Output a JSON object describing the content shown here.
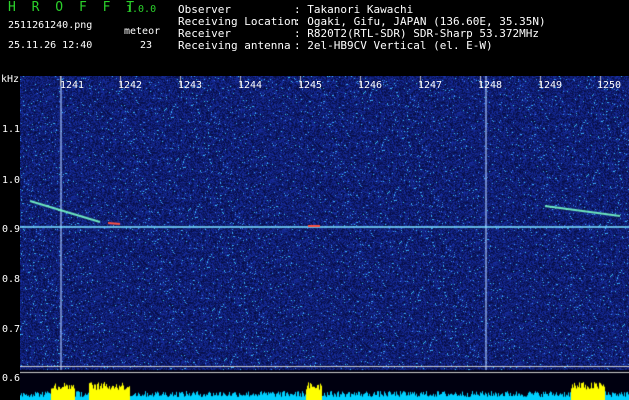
{
  "app": {
    "title": "H R O F F T",
    "version": "1.0.0"
  },
  "file": {
    "name": "2511261240.png",
    "datetime": "25.11.26 12:40"
  },
  "meteor": {
    "label": "meteor",
    "count": "23"
  },
  "info": [
    {
      "key": "Observer",
      "value": ": Takanori Kawachi"
    },
    {
      "key": "Receiving Location",
      "value": ": Ogaki, Gifu, JAPAN (136.60E, 35.35N)"
    },
    {
      "key": "Receiver",
      "value": ": R820T2(RTL-SDR) SDR-Sharp 53.372MHz"
    },
    {
      "key": "Receiving antenna",
      "value": ": 2el-HB9CV Vertical (el. E-W)"
    }
  ],
  "yaxis": {
    "unit": "kHz",
    "ticks": [
      "1.1",
      "1.0",
      "0.9",
      "0.8",
      "0.7",
      "0.6"
    ]
  },
  "xaxis": {
    "ticks": [
      "1241",
      "1242",
      "1243",
      "1244",
      "1245",
      "1246",
      "1247",
      "1248",
      "1249",
      "1250"
    ]
  },
  "colors": {
    "background": "#000000",
    "noise": "#1020a0",
    "accent": "#2bd12b",
    "signal": "#00e0ff"
  }
}
